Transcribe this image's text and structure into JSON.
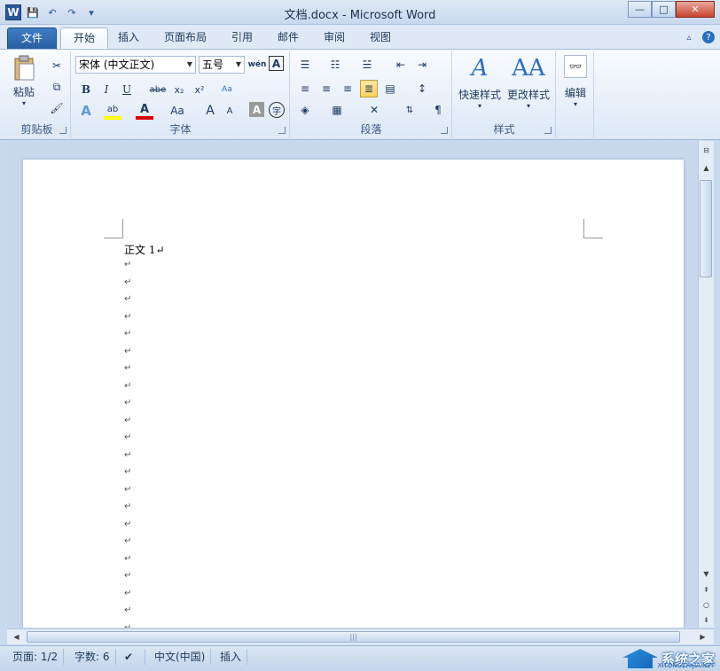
{
  "window": {
    "title": "文档.docx - Microsoft Word",
    "app_icon": "W",
    "controls": {
      "minimize": "—",
      "maximize": "□",
      "close": "✕"
    }
  },
  "quick_access": {
    "save": "💾",
    "undo": "↶",
    "redo": "↷",
    "customize": "▾"
  },
  "tabs": [
    {
      "label": "文件"
    },
    {
      "label": "开始"
    },
    {
      "label": "插入"
    },
    {
      "label": "页面布局"
    },
    {
      "label": "引用"
    },
    {
      "label": "邮件"
    },
    {
      "label": "审阅"
    },
    {
      "label": "视图"
    }
  ],
  "ribbon": {
    "clipboard": {
      "label": "剪贴板",
      "paste": "粘贴",
      "cut_icon": "✂",
      "copy_icon": "⧉",
      "format_painter_icon": "🖌"
    },
    "font": {
      "label": "字体",
      "font_name": "宋体 (中文正文)",
      "font_size": "五号",
      "pinyin": "wén",
      "border_char": "A",
      "bold": "B",
      "italic": "I",
      "underline": "U",
      "strike": "abe",
      "subscript": "x₂",
      "superscript": "x²",
      "clear_format": "Aa",
      "text_effect": "A",
      "highlight": "ab",
      "font_color": "A",
      "change_case": "Aa",
      "grow": "A",
      "shrink": "A",
      "shade": "A",
      "enclose": "字"
    },
    "paragraph": {
      "label": "段落"
    },
    "styles": {
      "label": "样式",
      "quick_styles": "快速样式",
      "change_styles": "更改样式"
    },
    "editing": {
      "label": "编辑",
      "find": "编辑"
    }
  },
  "document": {
    "first_line": "正文 1↵",
    "paragraph_mark": "↵",
    "empty_lines": 22
  },
  "statusbar": {
    "page": "页面: 1/2",
    "words": "字数: 6",
    "language": "中文(中国)",
    "mode": "插入"
  },
  "watermark": {
    "text": "系统之家",
    "sub": "XITONGZHIJIA.NET"
  },
  "colors": {
    "file_tab": "#2a5fa3",
    "accent": "#2b579a",
    "selected_button": "#ffd35a"
  }
}
